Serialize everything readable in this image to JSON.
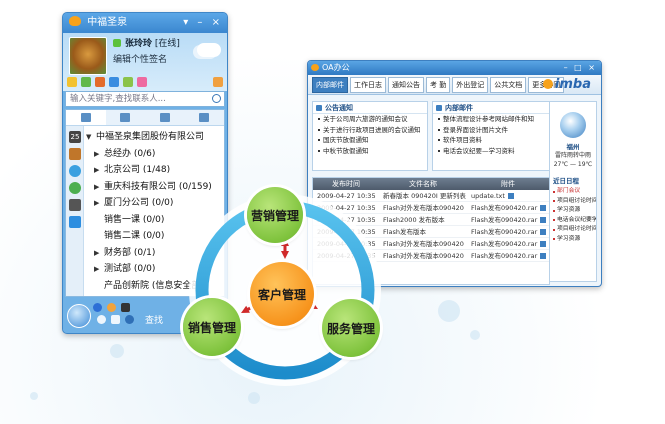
{
  "im": {
    "title": "中福圣泉",
    "user_name": "张玲玲",
    "status": "[在线]",
    "signature": "编辑个性签名",
    "search_placeholder": "输入关键字,查找联系人...",
    "tree": [
      {
        "label": "中福圣泉集团股份有限公司",
        "expanded": true
      },
      {
        "label": "总经办 (0/6)",
        "expanded": false
      },
      {
        "label": "北京公司 (1/48)",
        "expanded": false
      },
      {
        "label": "重庆科技有限公司 (0/159)",
        "expanded": false
      },
      {
        "label": "厦门分公司 (0/0)",
        "expanded": false
      },
      {
        "label": "销售一课 (0/0)",
        "expanded": false
      },
      {
        "label": "销售二课 (0/0)",
        "expanded": false
      },
      {
        "label": "财务部 (0/1)",
        "expanded": false
      },
      {
        "label": "测试部 (0/0)",
        "expanded": false
      },
      {
        "label": "产品创新院 (信息安全部)",
        "expanded": false
      }
    ],
    "footer_search": "查找",
    "side_number": "25"
  },
  "oa": {
    "title": "OA办公",
    "nav": [
      "内部邮件",
      "工作日志",
      "通知公告",
      "考  勤",
      "外出登记",
      "公共文档",
      "更多协同"
    ],
    "logo": "imba",
    "notice_title": "公告通知",
    "notices": [
      "关于公司周六旅游的通知会议",
      "关于进行行政项目进展的会议通知",
      "国庆节放假通知",
      "中秋节放假通知"
    ],
    "mail_title": "内部邮件",
    "mails": [
      "整体流程设计参考网站邮件和知",
      "登录界面设计图片文件",
      "软件项目资料",
      "电话会议纪要—学习资料"
    ],
    "docs_header": [
      "发布时间",
      "文件名称",
      "附件"
    ],
    "docs": [
      {
        "time": "2009-04-27 10:35",
        "name": "新春版本 090420I 更新列表",
        "file": "update.txt"
      },
      {
        "time": "2009-04-27 10:35",
        "name": "Flash对外发布版本090420",
        "file": "Flash发布090420.rar"
      },
      {
        "time": "2009-04-27 10:35",
        "name": "Flash2000 发布版本",
        "file": "Flash发布090420.rar"
      },
      {
        "time": "2009-04-27 10:35",
        "name": "Flash发布版本",
        "file": "Flash发布090420.rar"
      },
      {
        "time": "2009-04-27 10:35",
        "name": "Flash对外发布版本090420",
        "file": "Flash发布090420.rar"
      },
      {
        "time": "2009-04-27 10:35",
        "name": "Flash对外发布版本090420",
        "file": "Flash发布090420.rar"
      }
    ],
    "weather_city": "福州",
    "weather_desc": "雷阵雨转中雨",
    "weather_temp": "27℃ — 19℃",
    "schedule_title": "近日日程",
    "schedule": [
      "部门会议",
      "项目组讨论时间",
      "学习资源",
      "电话会议纪要学习资料",
      "项目组讨论时间",
      "学习资源"
    ]
  },
  "diagram": {
    "center": "客户管理",
    "top": "营销管理",
    "left": "销售管理",
    "right": "服务管理"
  },
  "colors": {
    "ring": "#2ea6dd",
    "green_node": "#7fc33d",
    "orange_node": "#f7941d",
    "arrow": "#d02a2a"
  }
}
